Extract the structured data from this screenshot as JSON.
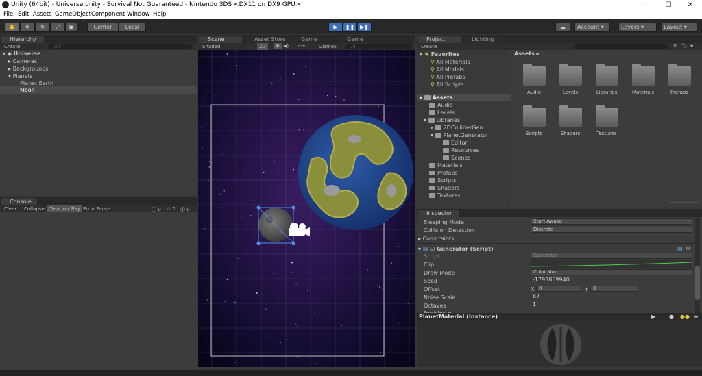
{
  "window": {
    "title": "Unity (64bit) - Universe.unity - Survival Not Guaranteed - Nintendo 3DS <DX11 on DX9 GPU>",
    "min": "—",
    "max": "☐",
    "close": "✕"
  },
  "menu": [
    "File",
    "Edit",
    "Assets",
    "GameObject",
    "Component",
    "Window",
    "Help"
  ],
  "toolbar": {
    "center": "Center",
    "local": "Local",
    "account": "Account",
    "layers": "Layers",
    "layout": "Layout"
  },
  "hierarchy": {
    "tab": "Hierarchy",
    "create": "Create",
    "search": "All",
    "scene": "Universe",
    "items": [
      "Cameras",
      "Backgrounds",
      "Planets",
      "Planet Earth",
      "Moon"
    ]
  },
  "console": {
    "tab": "Console",
    "buttons": [
      "Clear",
      "Collapse",
      "Clear on Play",
      "Error Pause"
    ],
    "counts": [
      "0",
      "0",
      "0"
    ]
  },
  "scene_tabs": {
    "scene": "Scene",
    "asset_store": "Asset Store",
    "game1": "Game",
    "game2": "Game"
  },
  "scene_bar": {
    "shaded": "Shaded",
    "mode2d": "2D",
    "gizmos": "Gizmos",
    "search": "All"
  },
  "project": {
    "tab": "Project",
    "lighting": "Lighting",
    "create": "Create",
    "favorites": "Favorites",
    "fav_items": [
      "All Materials",
      "All Models",
      "All Prefabs",
      "All Scripts"
    ],
    "assets": "Assets",
    "tree": [
      "Audio",
      "Levels",
      "Libraries",
      "2DColliderGen",
      "PlanetGenerator",
      "Editor",
      "Resources",
      "Scenes",
      "Materials",
      "Prefabs",
      "Scripts",
      "Shaders",
      "Textures"
    ],
    "breadcrumb": "Assets",
    "grid": [
      "Audio",
      "Levels",
      "Libraries",
      "Materials",
      "Prefabs",
      "Scripts",
      "Shaders",
      "Textures"
    ]
  },
  "inspector": {
    "tab": "Inspector",
    "sleeping_label": "Sleeping Mode",
    "sleeping_value": "Start Awake",
    "collision_label": "Collision Detection",
    "collision_value": "Discrete",
    "constraints": "Constraints",
    "component": "Generator (Script)",
    "script_label": "Script",
    "script_value": "Generator",
    "clip_label": "Clip",
    "draw_label": "Draw Mode",
    "draw_value": "Color Map",
    "seed_label": "Seed",
    "seed_value": "-1793859940",
    "offset_label": "Offset",
    "offset_x_label": "X",
    "offset_x": "0",
    "offset_y_label": "Y",
    "offset_y": "0",
    "noise_label": "Noise Scale",
    "noise_value": "87",
    "octaves_label": "Octaves",
    "octaves_value": "1",
    "persistence_label": "Persistence",
    "material": "PlanetMaterial (Instance)"
  }
}
